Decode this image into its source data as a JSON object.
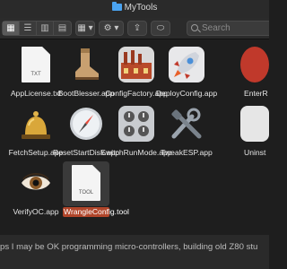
{
  "window": {
    "title": "MyTools"
  },
  "toolbar": {
    "view_modes": [
      "▦",
      "☰",
      "▥",
      "▤"
    ],
    "group_glyph": "▦ ▾",
    "action_glyph": "⚙ ▾",
    "share_glyph": "⇪",
    "tag_glyph": "⬭",
    "search_placeholder": "Search"
  },
  "files": [
    {
      "name": "AppLicense.txt",
      "icon": "text-document-icon",
      "tag": "TXT"
    },
    {
      "name": "BootBlesser.app",
      "icon": "boot-icon"
    },
    {
      "name": "ConfigFactory.app",
      "icon": "factory-icon"
    },
    {
      "name": "DeployConfig.app",
      "icon": "rocket-icon"
    },
    {
      "name": "EnterR",
      "icon": "red-app-icon"
    },
    {
      "name": "FetchSetup.app",
      "icon": "bell-icon"
    },
    {
      "name": "ResetStartDisk.app",
      "icon": "compass-icon"
    },
    {
      "name": "SwitchRunMode.app",
      "icon": "switch-panel-icon"
    },
    {
      "name": "TweakESP.app",
      "icon": "tools-icon"
    },
    {
      "name": "Uninst",
      "icon": "uninstall-icon"
    },
    {
      "name": "VerifyOC.app",
      "icon": "eye-icon"
    },
    {
      "name": "WrangleConfig.tool",
      "icon": "tool-document-icon",
      "tag": "TOOL",
      "selected": true
    }
  ],
  "footer_text": "ps I may be OK programming micro-controllers, building old Z80 stu"
}
